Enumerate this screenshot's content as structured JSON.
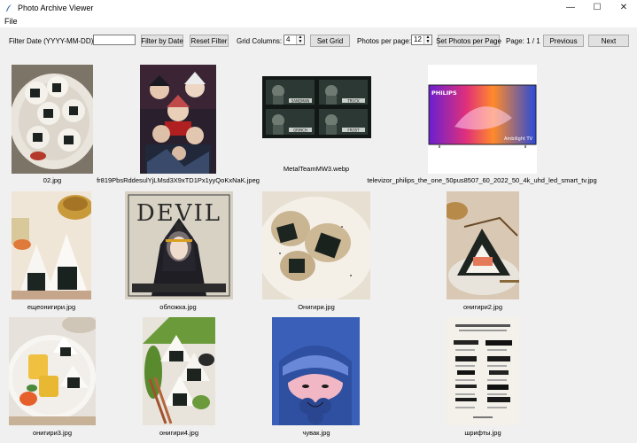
{
  "window": {
    "title": "Photo Archive Viewer",
    "minimize_glyph": "—",
    "maximize_glyph": "☐",
    "close_glyph": "✕"
  },
  "menu": {
    "file": "File"
  },
  "toolbar": {
    "filter_date_label": "Filter Date (YYYY-MM-DD):",
    "filter_date_value": "",
    "filter_by_date": "Filter by Date",
    "reset_filter": "Reset Filter",
    "grid_columns_label": "Grid Columns:",
    "grid_columns_value": "4",
    "set_grid": "Set Grid",
    "photos_per_page_label": "Photos per page:",
    "photos_per_page_value": "12",
    "set_photos_per_page": "Set Photos per Page",
    "page_info": "Page: 1 / 1",
    "previous": "Previous",
    "next": "Next"
  },
  "photos": [
    {
      "caption": "02.jpg"
    },
    {
      "caption": "fr819PbsRddesulYjLMsd3X9xTD1Px1yyQoKxNaK.jpeg"
    },
    {
      "caption": "MetalTeamMW3.webp",
      "thumb_labels": [
        "SANDMAN",
        "TRUCK",
        "GRINCH",
        "FROST"
      ]
    },
    {
      "caption": "televizor_philips_the_one_50pus8507_60_2022_50_4k_uhd_led_smart_tv.jpg",
      "thumb_labels": [
        "PHILIPS",
        "Ambilight TV"
      ]
    },
    {
      "caption": "ещеонигири.jpg"
    },
    {
      "caption": "обложка.jpg",
      "thumb_labels": [
        "DEVIL"
      ]
    },
    {
      "caption": "Онигири.jpg"
    },
    {
      "caption": "онигири2.jpg"
    },
    {
      "caption": "онигири3.jpg"
    },
    {
      "caption": "онигири4.jpg"
    },
    {
      "caption": "чувак.jpg"
    },
    {
      "caption": "шрифты.jpg"
    }
  ]
}
